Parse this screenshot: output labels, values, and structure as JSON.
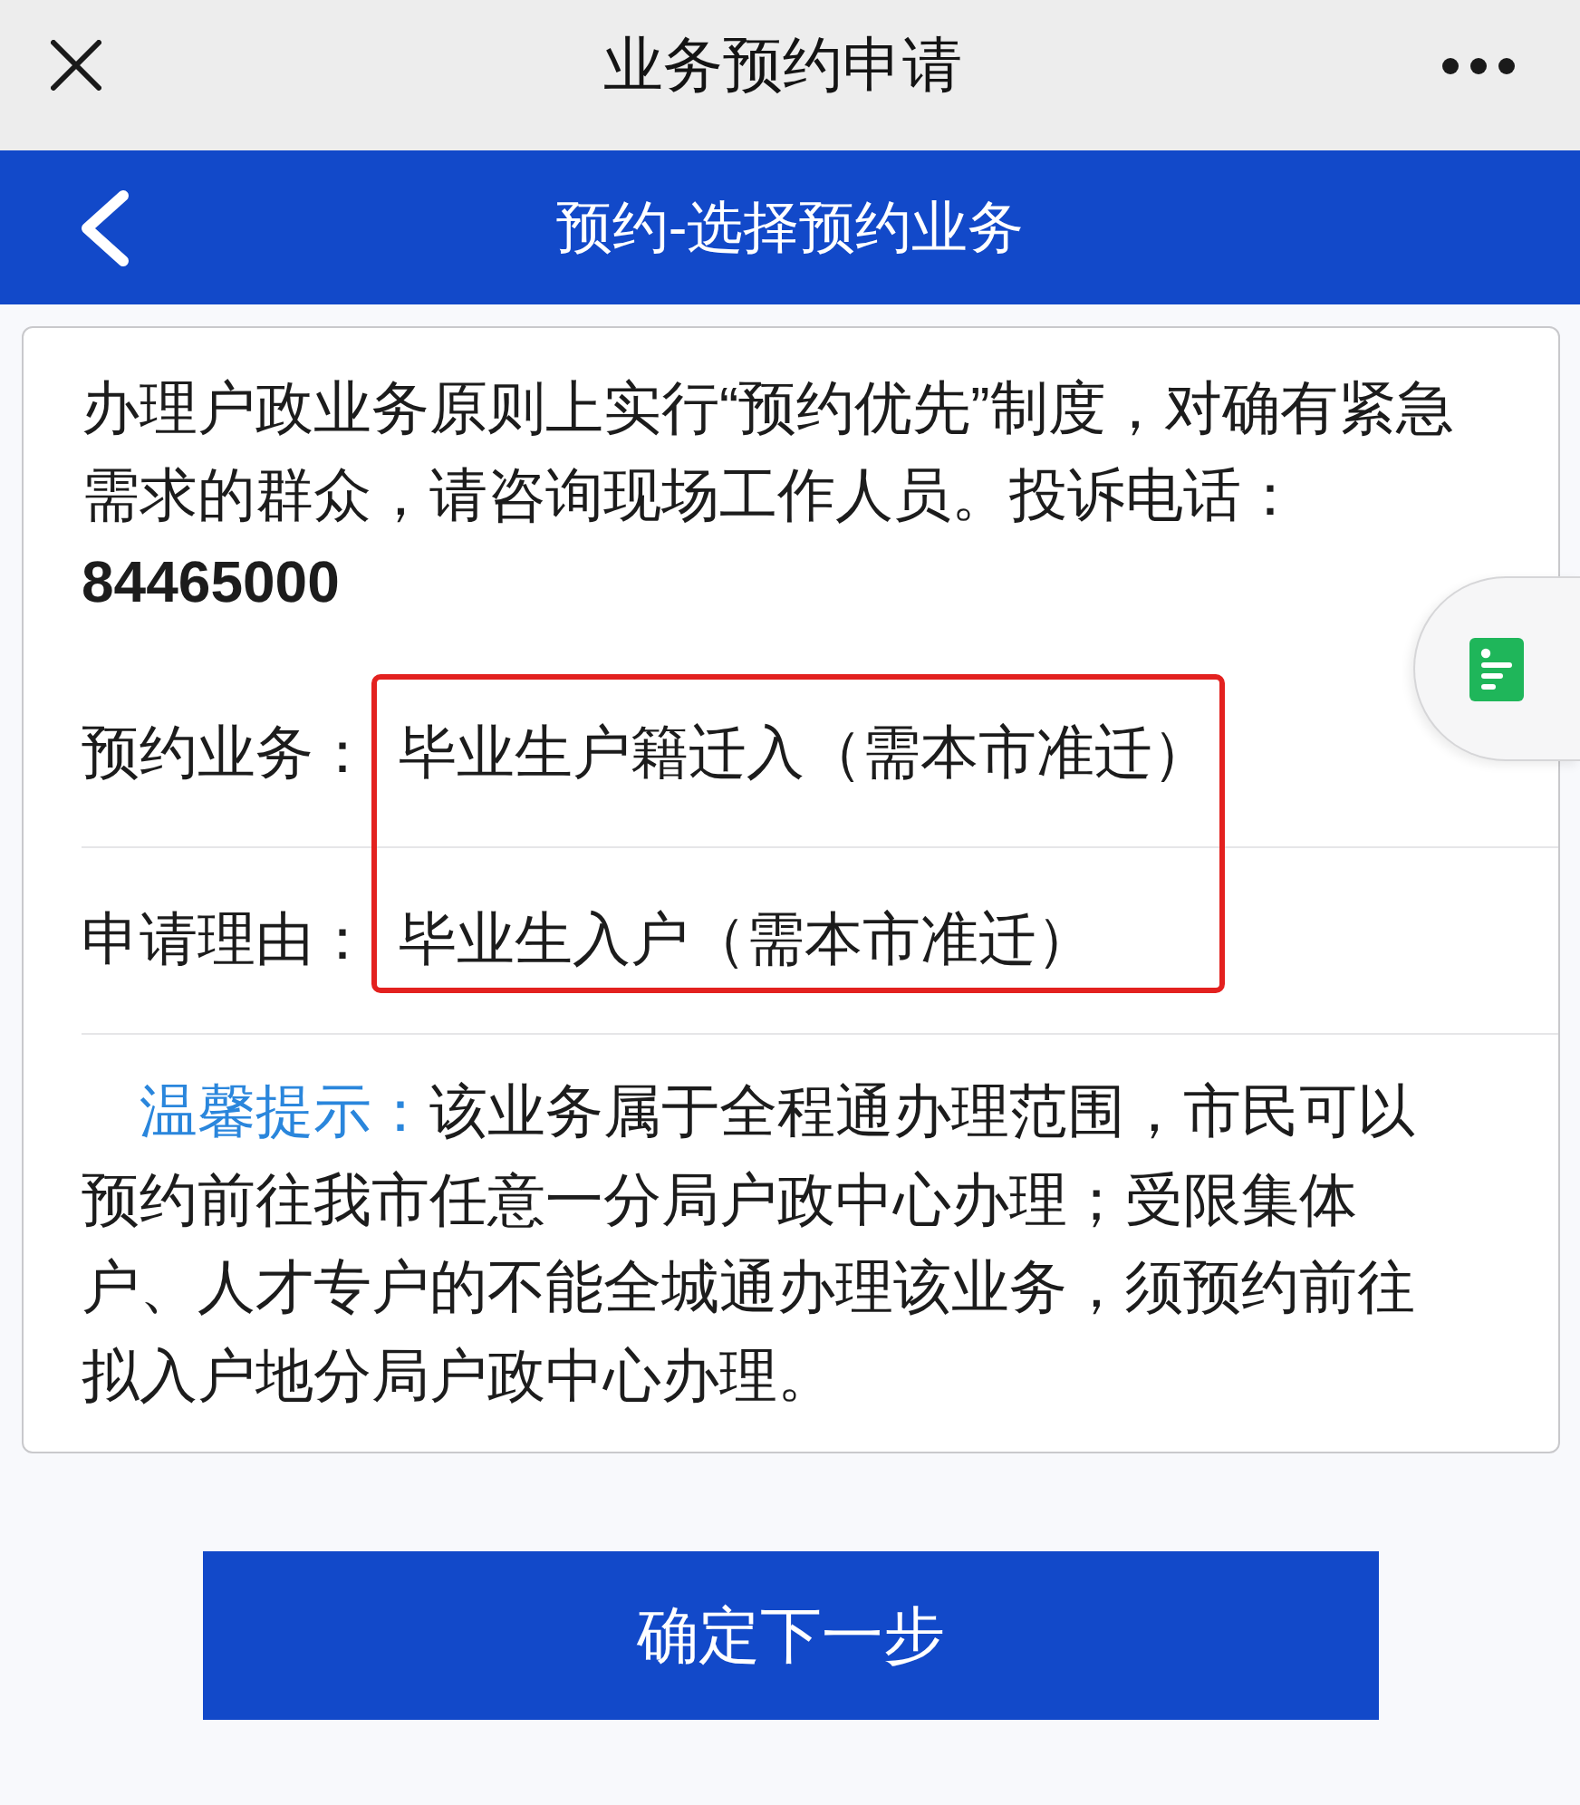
{
  "top_bar": {
    "title": "业务预约申请"
  },
  "header": {
    "title": "预约-选择预约业务"
  },
  "notice": "办理户政业务原则上实行“预约优先”制度，对确有紧急需求的群众，请咨询现场工作人员。投诉电话：**84465000**",
  "form": {
    "highlighted": true,
    "rows": [
      {
        "label": "预约业务：",
        "value": "毕业生户籍迁入（需本市准迁）"
      },
      {
        "label": "申请理由：",
        "value": "毕业生入户（需本市准迁）"
      }
    ]
  },
  "tip": {
    "label": "温馨提示：",
    "text": "该业务属于全程通办理范围，市民可以预约前往我市任意一分局户政中心办理；受限集体户、人才专户的不能全城通办理该业务，须预约前往拟入户地分局户政中心办理。"
  },
  "button": {
    "label": "确定下一步"
  }
}
